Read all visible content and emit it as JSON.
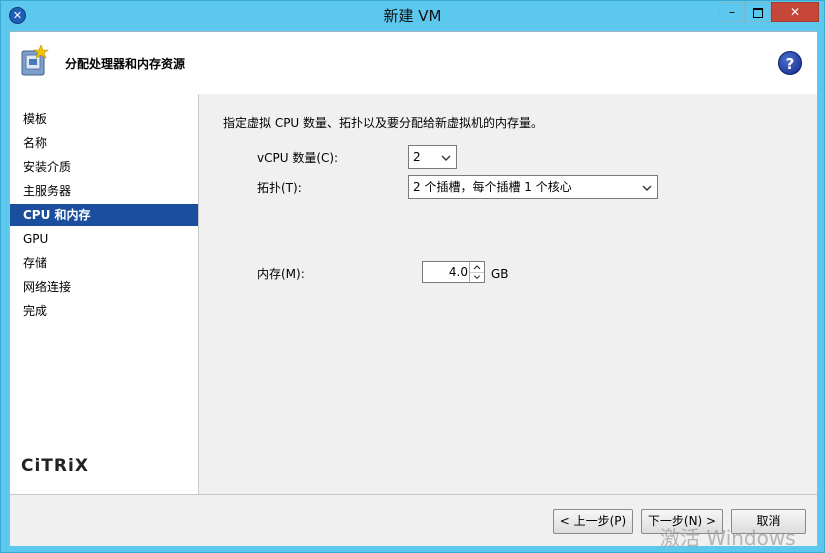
{
  "window": {
    "title": "新建 VM",
    "minimize_glyph": "–",
    "close_glyph": "✕"
  },
  "header": {
    "title": "分配处理器和内存资源",
    "help_glyph": "?"
  },
  "sidebar": {
    "items": [
      {
        "label": "模板"
      },
      {
        "label": "名称"
      },
      {
        "label": "安装介质"
      },
      {
        "label": "主服务器"
      },
      {
        "label": "CPU 和内存",
        "selected": true
      },
      {
        "label": "GPU"
      },
      {
        "label": "存储"
      },
      {
        "label": "网络连接"
      },
      {
        "label": "完成"
      }
    ],
    "logo": "CiTRiX"
  },
  "main": {
    "description": "指定虚拟 CPU 数量、拓扑以及要分配给新虚拟机的内存量。",
    "vcpu_label": "vCPU 数量(C):",
    "vcpu_value": "2",
    "topology_label": "拓扑(T):",
    "topology_value": "2 个插槽，每个插槽 1 个核心",
    "memory_label": "内存(M):",
    "memory_value": "4.0",
    "memory_unit": "GB"
  },
  "footer": {
    "prev_label": "< 上一步(P)",
    "next_label": "下一步(N) >",
    "cancel_label": "取消"
  },
  "watermark": "激活 Windows",
  "colors": {
    "titlebar": "#5cc8ee",
    "selection": "#1b4f9e",
    "close_button": "#c7463a"
  }
}
